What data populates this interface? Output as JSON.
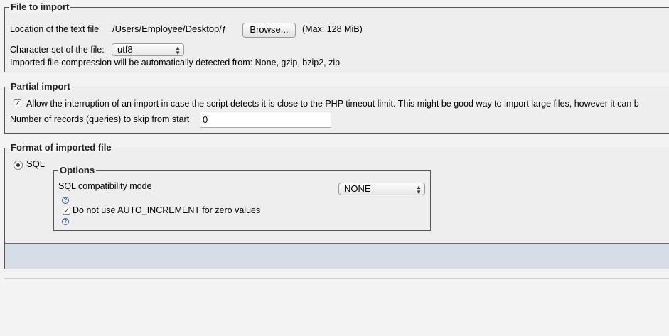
{
  "file_to_import": {
    "legend": "File to import",
    "location_label": "Location of the text file",
    "file_path": "/Users/Employee/Desktop/ƒ",
    "browse_label": "Browse...",
    "max_size": "(Max: 128 MiB)",
    "charset_label": "Character set of the file:",
    "charset_value": "utf8",
    "compression_note": "Imported file compression will be automatically detected from: None, gzip, bzip2, zip"
  },
  "partial_import": {
    "legend": "Partial import",
    "allow_interrupt_label": "Allow the interruption of an import in case the script detects it is close to the PHP timeout limit. This might be good way to import large files, however it can b",
    "allow_interrupt_checked": true,
    "skip_label": "Number of records (queries) to skip from start",
    "skip_value": "0"
  },
  "format": {
    "legend": "Format of imported file",
    "sql_label": "SQL",
    "sql_selected": true,
    "options": {
      "legend": "Options",
      "compat_label": "SQL compatibility mode",
      "compat_value": "NONE",
      "help_icon": "?",
      "no_auto_inc_label": "Do not use AUTO_INCREMENT for zero values",
      "no_auto_inc_checked": true
    }
  },
  "icons": {
    "checkmark": "✓",
    "arrow_up": "▲",
    "arrow_down": "▼"
  }
}
